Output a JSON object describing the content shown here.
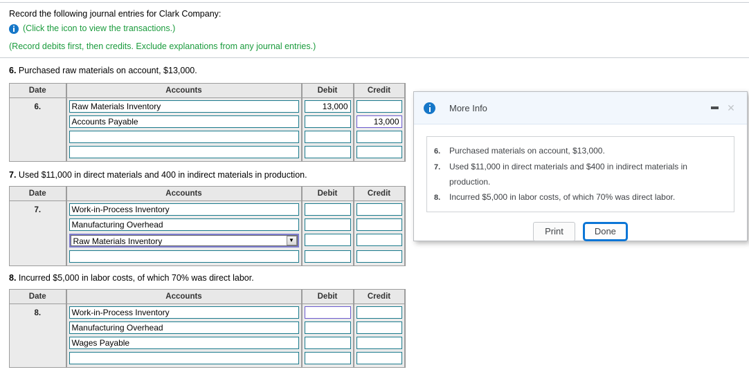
{
  "prompt": {
    "line1": "Record the following journal entries for Clark Company:",
    "icon_hint": "(Click the icon to view the transactions.)",
    "instruction": "(Record debits first, then credits. Exclude explanations from any journal entries.)",
    "info_icon_name": "info-icon",
    "accent_green": "#1a9b3c",
    "accent_blue": "#1677c8"
  },
  "columns": {
    "date": "Date",
    "accounts": "Accounts",
    "debit": "Debit",
    "credit": "Credit"
  },
  "entries": [
    {
      "label_number": "6.",
      "label_text": "Purchased raw materials on account, $13,000.",
      "date": "6.",
      "rows": [
        {
          "account": "Raw Materials Inventory",
          "debit": "13,000",
          "credit": "",
          "account_type": "text",
          "focus": ""
        },
        {
          "account": "Accounts Payable",
          "debit": "",
          "credit": "13,000",
          "account_type": "text",
          "focus": "credit"
        },
        {
          "account": "",
          "debit": "",
          "credit": "",
          "account_type": "text",
          "focus": ""
        },
        {
          "account": "",
          "debit": "",
          "credit": "",
          "account_type": "text",
          "focus": ""
        }
      ]
    },
    {
      "label_number": "7.",
      "label_text": "Used $11,000 in direct materials and 400 in indirect materials in production.",
      "date": "7.",
      "rows": [
        {
          "account": "Work-in-Process Inventory",
          "debit": "",
          "credit": "",
          "account_type": "text",
          "focus": ""
        },
        {
          "account": "Manufacturing Overhead",
          "debit": "",
          "credit": "",
          "account_type": "text",
          "focus": ""
        },
        {
          "account": "Raw Materials Inventory",
          "debit": "",
          "credit": "",
          "account_type": "select",
          "focus": ""
        },
        {
          "account": "",
          "debit": "",
          "credit": "",
          "account_type": "text",
          "focus": ""
        }
      ]
    },
    {
      "label_number": "8.",
      "label_text": "Incurred $5,000 in labor costs, of which 70% was direct labor.",
      "date": "8.",
      "rows": [
        {
          "account": "Work-in-Process Inventory",
          "debit": "",
          "credit": "",
          "account_type": "text",
          "focus": "debit"
        },
        {
          "account": "Manufacturing Overhead",
          "debit": "",
          "credit": "",
          "account_type": "text",
          "focus": ""
        },
        {
          "account": "Wages Payable",
          "debit": "",
          "credit": "",
          "account_type": "text",
          "focus": ""
        },
        {
          "account": "",
          "debit": "",
          "credit": "",
          "account_type": "text",
          "focus": ""
        }
      ]
    }
  ],
  "dialog": {
    "title": "More Info",
    "icon_name": "info-icon",
    "minimize_label": "—",
    "close_label": "✕",
    "transactions": [
      {
        "num": "6.",
        "text": "Purchased materials on account, $13,000."
      },
      {
        "num": "7.",
        "text": "Used $11,000 in direct materials and $400 in indirect materials in production."
      },
      {
        "num": "8.",
        "text": "Incurred $5,000 in labor costs, of which 70% was direct labor."
      }
    ],
    "print_label": "Print",
    "done_label": "Done",
    "primary_color": "#0c76d6"
  }
}
